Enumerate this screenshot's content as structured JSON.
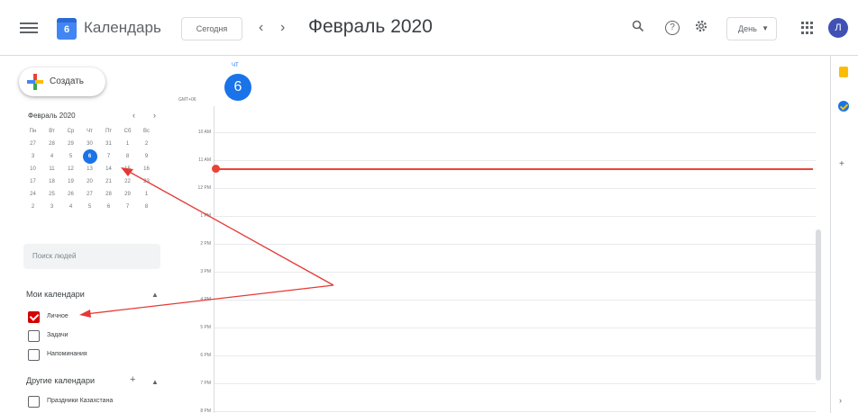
{
  "header": {
    "app_title": "Календарь",
    "logo_day": "6",
    "today_label": "Сегодня",
    "prev_label": "‹",
    "next_label": "›",
    "month_title": "Февраль 2020",
    "view_label": "День",
    "avatar_letter": "Л"
  },
  "sidebar": {
    "create_label": "Создать",
    "mini_title": "Февраль 2020",
    "weekdays": [
      "Пн",
      "Вт",
      "Ср",
      "Чт",
      "Пт",
      "Сб",
      "Вс"
    ],
    "weeks": [
      [
        "27",
        "28",
        "29",
        "30",
        "31",
        "1",
        "2"
      ],
      [
        "3",
        "4",
        "5",
        "6",
        "7",
        "8",
        "9"
      ],
      [
        "10",
        "11",
        "12",
        "13",
        "14",
        "15",
        "16"
      ],
      [
        "17",
        "18",
        "19",
        "20",
        "21",
        "22",
        "23"
      ],
      [
        "24",
        "25",
        "26",
        "27",
        "28",
        "29",
        "1"
      ],
      [
        "2",
        "3",
        "4",
        "5",
        "6",
        "7",
        "8"
      ]
    ],
    "selected_day": "6",
    "people_search_placeholder": "Поиск людей",
    "my_calendars_title": "Мои календари",
    "my_calendars": [
      {
        "label": "Личное",
        "checked": true
      },
      {
        "label": "Задачи",
        "checked": false
      },
      {
        "label": "Напоминания",
        "checked": false
      }
    ],
    "other_calendars_title": "Другие календари",
    "other_calendars": [
      {
        "label": "Праздники Казахстана",
        "checked": false
      }
    ]
  },
  "day_view": {
    "weekday_abbr": "ЧТ",
    "day_number": "6",
    "timezone": "GMT+06",
    "hours": [
      "10 AM",
      "11 AM",
      "12 PM",
      "1 PM",
      "2 PM",
      "3 PM",
      "4 PM",
      "5 PM",
      "6 PM",
      "7 PM",
      "8 PM"
    ]
  },
  "colors": {
    "accent": "#1a73e8",
    "current_time": "#ea4335",
    "personal_calendar": "#d50000",
    "annotation_arrow": "#e53935"
  }
}
